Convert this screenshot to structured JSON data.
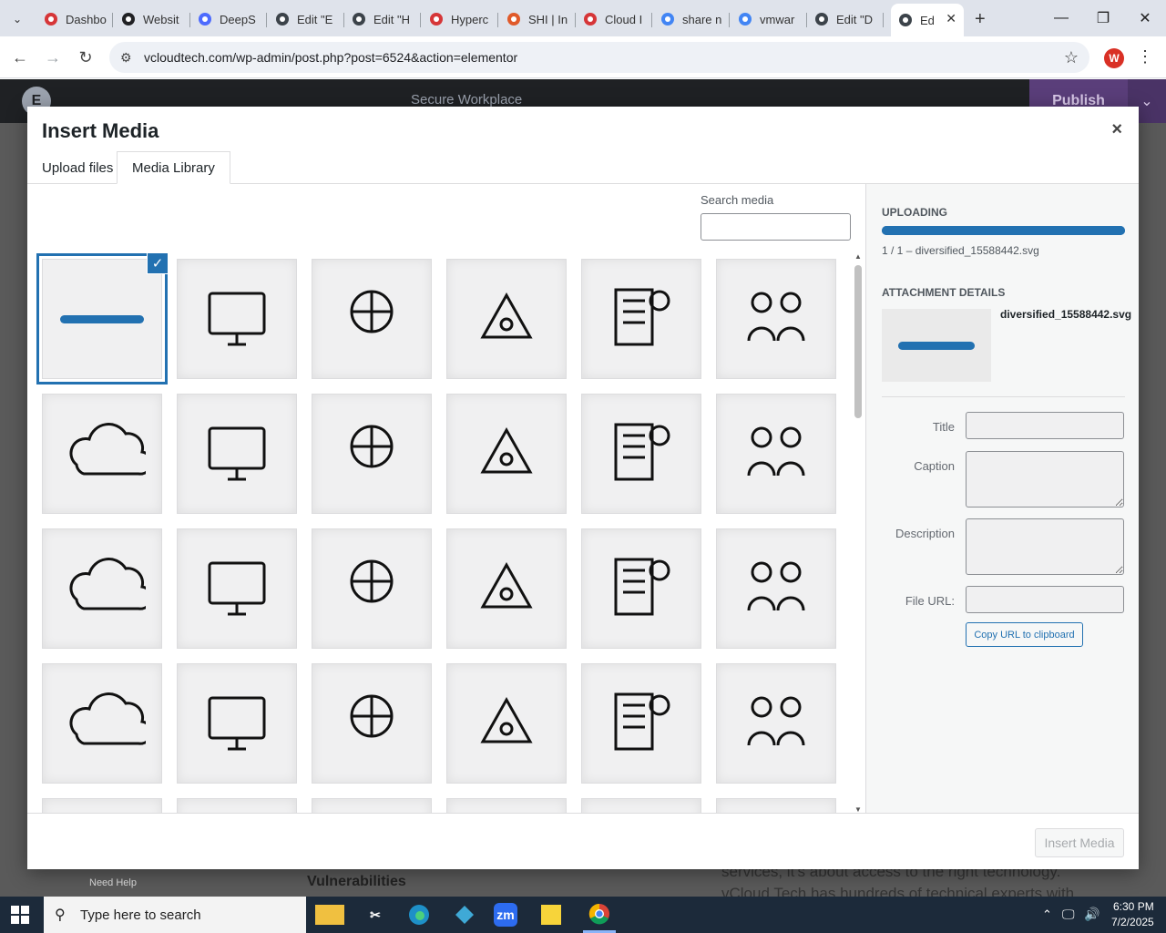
{
  "browser": {
    "tabs": [
      {
        "label": "Dashbo",
        "icon": "app-icon-red-diamond",
        "color": "#d63638"
      },
      {
        "label": "Websit",
        "icon": "globe-dark-icon",
        "color": "#202124"
      },
      {
        "label": "DeepS",
        "icon": "deepseek-whale-icon",
        "color": "#4d6bfe"
      },
      {
        "label": "Edit \"E",
        "icon": "wordpress-icon",
        "color": "#3c434a"
      },
      {
        "label": "Edit \"H",
        "icon": "wordpress-icon",
        "color": "#3c434a"
      },
      {
        "label": "Hyperc",
        "icon": "app-icon-red-diamond",
        "color": "#d63638"
      },
      {
        "label": "SHI | In",
        "icon": "shi-ring-icon",
        "color": "#e05a2a"
      },
      {
        "label": "Cloud I",
        "icon": "cloud-slash-icon",
        "color": "#d63638"
      },
      {
        "label": "share n",
        "icon": "google-icon",
        "color": "#4285f4"
      },
      {
        "label": "vmwar",
        "icon": "google-icon",
        "color": "#4285f4"
      },
      {
        "label": "Edit \"D",
        "icon": "wordpress-icon",
        "color": "#3c434a"
      },
      {
        "label": "Ed",
        "icon": "wordpress-icon",
        "color": "#3c434a",
        "active": true
      }
    ],
    "new_tab": "+",
    "url": "vcloudtech.com/wp-admin/post.php?post=6524&action=elementor",
    "profile_initial": "W"
  },
  "editor": {
    "title": "Secure Workplace",
    "publish": "Publish",
    "need_help": "Need Help",
    "bg_heading": "Vulnerabilities",
    "bg_text1": "services, it's about access to the right technology.",
    "bg_text2": "vCloud Tech has hundreds of technical experts with"
  },
  "modal": {
    "title": "Insert Media",
    "close": "×",
    "tabs": [
      "Upload files",
      "Media Library"
    ],
    "active_tab": 1,
    "search_label": "Search media",
    "search_value": "",
    "grid": [
      [
        "blue-bar-svg",
        "security-monitor-icon",
        "cloud-web-diamond-icon",
        "hand-gear-chat-icon",
        "cloud-dollar-hand-icon",
        "cloud-chip-arrows-icon"
      ],
      [
        "ai-cloud-circuit-icon",
        "remote-work-globe-icon",
        "cloud-brain-circuit-icon",
        "building-dollar-gear-icon",
        "building-bulb-monitor-icon",
        "people-money-cycle-icon"
      ],
      [
        "folder-globe-network-icon",
        "cloud-bulb-network-icon",
        "cloud-chip-wireless-icon",
        "cloud-bulb-idea-icon",
        "laptop-wifi-qr-icon",
        "people-clock-icon"
      ],
      [
        "monitor-download-gear-icon",
        "cloud-wrench-gear-icon",
        "cloud-gear-team-icon",
        "cloud-planet-arrows-icon",
        "gear-bulb-people-icon",
        "document-kucoin-icon"
      ]
    ],
    "sidebar": {
      "uploading_heading": "Uploading",
      "progress": 1.0,
      "upload_count": "1 / 1",
      "upload_file": "diversified_15588442.svg",
      "attachment_heading": "Attachment Details",
      "file_name": "diversified_15588442.svg",
      "fields": [
        {
          "label": "Title",
          "value": ""
        },
        {
          "label": "Caption",
          "value": ""
        },
        {
          "label": "Description",
          "value": ""
        },
        {
          "label": "File URL:",
          "value": ""
        }
      ],
      "copy_url": "Copy URL to clipboard"
    },
    "insert_button": "Insert Media"
  },
  "taskbar": {
    "search_placeholder": "Type here to search",
    "time": "6:30 PM",
    "date": "7/2/2025",
    "zoom_label": "zm"
  }
}
